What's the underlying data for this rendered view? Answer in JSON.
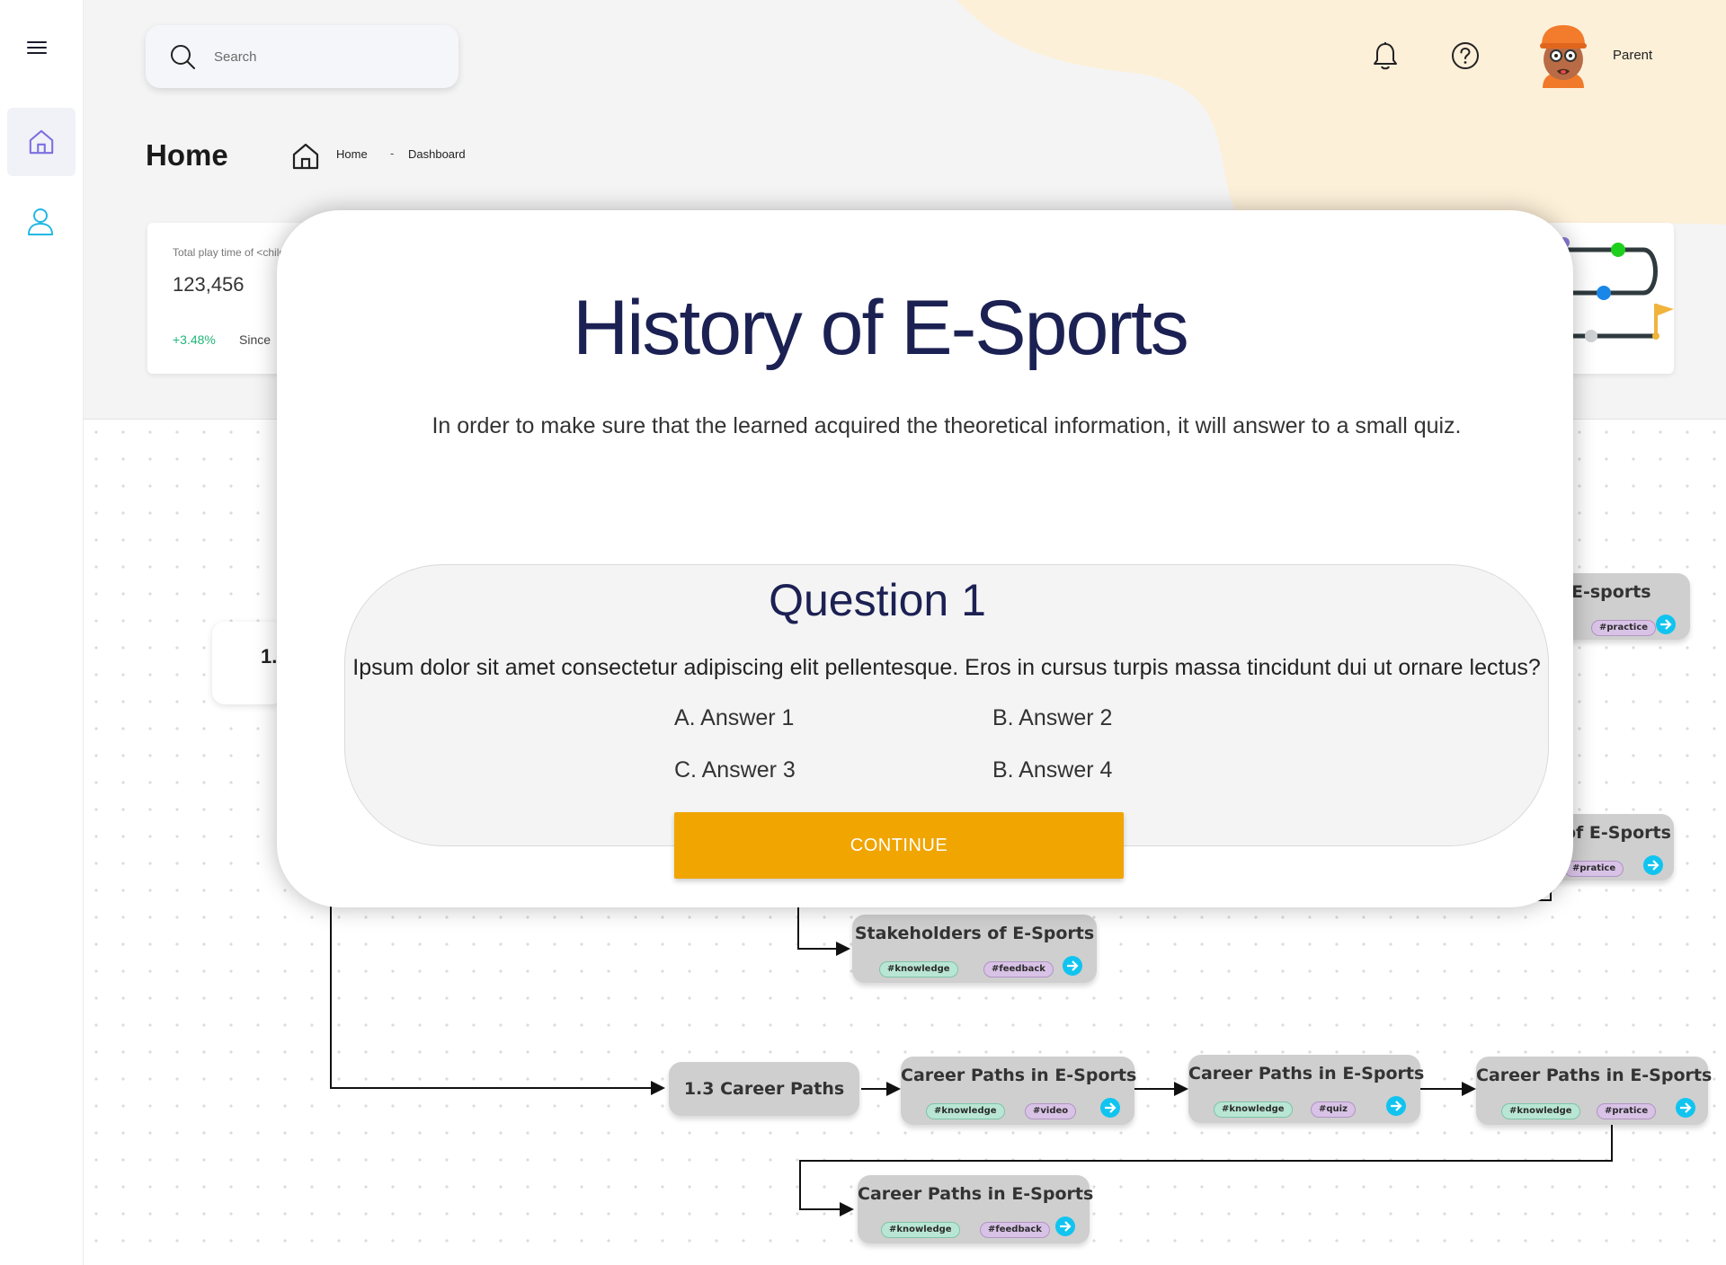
{
  "sidebar": {
    "menu_icon": "hamburger-icon",
    "items": [
      {
        "icon": "home-icon",
        "active": true
      },
      {
        "icon": "user-icon",
        "active": false
      }
    ]
  },
  "header": {
    "search_placeholder": "Search",
    "notification_icon": "bell-icon",
    "help_icon": "help-icon",
    "user_label": "Parent"
  },
  "page": {
    "title": "Home",
    "breadcrumb": [
      "Home",
      "Dashboard"
    ],
    "breadcrumb_separator": "-"
  },
  "stat_card": {
    "label": "Total play time of <child>",
    "value": "123,456",
    "change": "+3.48%",
    "since": "Since"
  },
  "flow": {
    "partial_node": "1.",
    "nodes": [
      {
        "title": "E-sports",
        "tags": [
          "#practice"
        ]
      },
      {
        "title": "of E-Sports",
        "tags": [
          "#pratice"
        ]
      },
      {
        "title": "Stakeholders of E-Sports",
        "tags": [
          "#knowledge",
          "#feedback"
        ]
      },
      {
        "title": "1.3 Career Paths",
        "tags": []
      },
      {
        "title": "Career Paths in E-Sports",
        "tags": [
          "#knowledge",
          "#video"
        ]
      },
      {
        "title": "Career Paths in E-Sports",
        "tags": [
          "#knowledge",
          "#quiz"
        ]
      },
      {
        "title": "Career Paths in E-Sports",
        "tags": [
          "#knowledge",
          "#pratice"
        ]
      },
      {
        "title": "Career Paths in E-Sports",
        "tags": [
          "#knowledge",
          "#feedback"
        ]
      }
    ]
  },
  "modal": {
    "title": "History of E-Sports",
    "subtitle": "In order to make sure that the learned acquired the theoretical information, it will answer to a small quiz.",
    "question": {
      "title": "Question 1",
      "text": "Ipsum dolor sit amet consectetur adipiscing elit pellentesque. Eros in cursus turpis massa tincidunt dui ut ornare lectus?",
      "answers": [
        "A. Answer 1",
        "B. Answer 2",
        "C. Answer 3",
        "B. Answer 4"
      ]
    },
    "continue_label": "CONTINUE"
  },
  "colors": {
    "accent_orange": "#f0a500",
    "title_navy": "#1c2153",
    "positive_green": "#22b57a",
    "go_button_cyan": "#11c4f0",
    "header_blob": "#fdf0d9"
  }
}
